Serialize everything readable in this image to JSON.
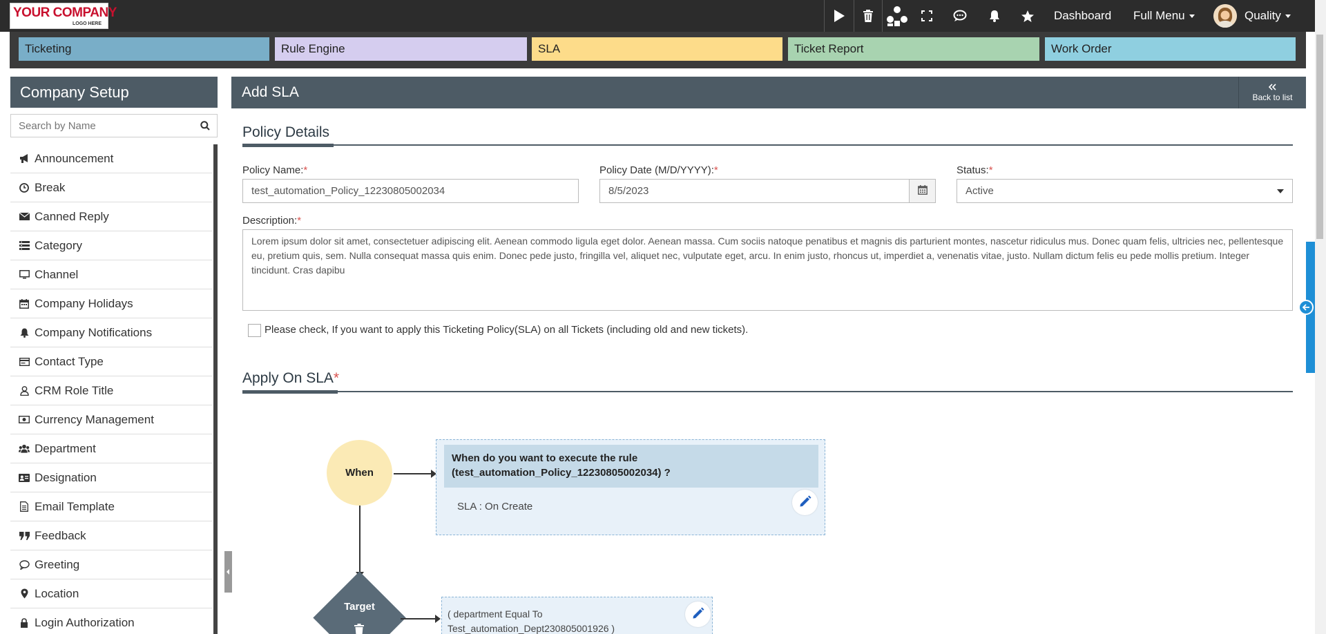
{
  "header": {
    "logo_main": "YOUR COMPANY",
    "logo_sub": "LOGO HERE",
    "dashboard_label": "Dashboard",
    "full_menu_label": "Full Menu",
    "user_name": "Quality"
  },
  "modules": [
    {
      "label": "Ticketing",
      "color": "#79aec8"
    },
    {
      "label": "Rule Engine",
      "color": "#d5cdef"
    },
    {
      "label": "SLA",
      "color": "#fddc8a"
    },
    {
      "label": "Ticket Report",
      "color": "#a8d3b0"
    },
    {
      "label": "Work Order",
      "color": "#8fcfe0"
    }
  ],
  "sidebar": {
    "title": "Company Setup",
    "search_placeholder": "Search by Name",
    "items": [
      {
        "label": "Announcement",
        "icon": "megaphone-icon"
      },
      {
        "label": "Break",
        "icon": "clock-icon"
      },
      {
        "label": "Canned Reply",
        "icon": "envelope-icon"
      },
      {
        "label": "Category",
        "icon": "list-icon"
      },
      {
        "label": "Channel",
        "icon": "monitor-icon"
      },
      {
        "label": "Company Holidays",
        "icon": "calendar-icon"
      },
      {
        "label": "Company Notifications",
        "icon": "bell-icon"
      },
      {
        "label": "Contact Type",
        "icon": "card-icon"
      },
      {
        "label": "CRM Role Title",
        "icon": "user-icon"
      },
      {
        "label": "Currency Management",
        "icon": "money-icon"
      },
      {
        "label": "Department",
        "icon": "users-icon"
      },
      {
        "label": "Designation",
        "icon": "id-card-icon"
      },
      {
        "label": "Email Template",
        "icon": "document-icon"
      },
      {
        "label": "Feedback",
        "icon": "quote-icon"
      },
      {
        "label": "Greeting",
        "icon": "chat-icon"
      },
      {
        "label": "Location",
        "icon": "pin-icon"
      },
      {
        "label": "Login Authorization",
        "icon": "lock-icon"
      }
    ]
  },
  "main": {
    "title": "Add SLA",
    "back_label": "Back to list",
    "policy_section": "Policy Details",
    "policy_name_label": "Policy Name:",
    "policy_name_value": "test_automation_Policy_12230805002034",
    "policy_date_label": "Policy Date (M/D/YYYY):",
    "policy_date_value": "8/5/2023",
    "status_label": "Status:",
    "status_value": "Active",
    "description_label": "Description:",
    "description_value": "Lorem ipsum dolor sit amet, consectetuer adipiscing elit. Aenean commodo ligula eget dolor. Aenean massa. Cum sociis natoque penatibus et magnis dis parturient montes, nascetur ridiculus mus. Donec quam felis, ultricies nec, pellentesque eu, pretium quis, sem. Nulla consequat massa quis enim. Donec pede justo, fringilla vel, aliquet nec, vulputate eget, arcu. In enim justo, rhoncus ut, imperdiet a, venenatis vitae, justo. Nullam dictum felis eu pede mollis pretium. Integer tincidunt. Cras dapibu",
    "apply_all_label": "Please check, If you want to apply this Ticketing Policy(SLA) on all Tickets (including old and new tickets).",
    "apply_section": "Apply On SLA",
    "required_mark": "*",
    "when_label": "When",
    "when_question": "When do you want to execute the rule (test_automation_Policy_12230805002034) ?",
    "when_value": "SLA : On Create",
    "target_label": "Target",
    "target_value_line1": "( department Equal To",
    "target_value_line2": "Test_automation_Dept230805001926 )"
  }
}
